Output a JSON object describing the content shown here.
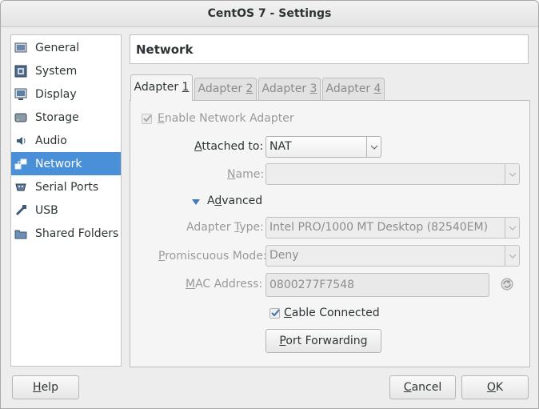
{
  "window": {
    "title": "CentOS 7 - Settings"
  },
  "sidebar": {
    "items": [
      {
        "label": "General",
        "icon": "general-icon"
      },
      {
        "label": "System",
        "icon": "system-icon"
      },
      {
        "label": "Display",
        "icon": "display-icon"
      },
      {
        "label": "Storage",
        "icon": "storage-icon"
      },
      {
        "label": "Audio",
        "icon": "audio-icon"
      },
      {
        "label": "Network",
        "icon": "network-icon",
        "selected": true
      },
      {
        "label": "Serial Ports",
        "icon": "serial-ports-icon"
      },
      {
        "label": "USB",
        "icon": "usb-icon"
      },
      {
        "label": "Shared Folders",
        "icon": "shared-folders-icon"
      }
    ]
  },
  "page": {
    "title": "Network"
  },
  "tabs": [
    {
      "text": "Adapter ",
      "num": "1",
      "active": true
    },
    {
      "text": "Adapter ",
      "num": "2"
    },
    {
      "text": "Adapter ",
      "num": "3"
    },
    {
      "text": "Adapter ",
      "num": "4"
    }
  ],
  "adapter": {
    "enable_label_pre": "",
    "enable_label_u": "E",
    "enable_label_post": "nable Network Adapter",
    "enabled_checked": true,
    "attached_to": {
      "label_u": "A",
      "label_post": "ttached to:",
      "value": "NAT"
    },
    "name": {
      "label_u": "N",
      "label_post": "ame:",
      "value": ""
    },
    "advanced": {
      "label_u": "d",
      "label_pre": "A",
      "label_post": "vanced",
      "expanded": true
    },
    "adapter_type": {
      "label_pre": "Adapter ",
      "label_u": "T",
      "label_post": "ype:",
      "value": "Intel PRO/1000 MT Desktop (82540EM)"
    },
    "promiscuous_mode": {
      "label_u": "P",
      "label_post": "romiscuous Mode:",
      "value": "Deny"
    },
    "mac_address": {
      "label_pre": "",
      "label_u": "M",
      "label_post": "AC Address:",
      "value": "0800277F7548"
    },
    "cable_connected": {
      "label_u": "C",
      "label_post": "able Connected",
      "checked": true
    },
    "port_forwarding": {
      "label_u": "P",
      "label_post": "ort Forwarding"
    }
  },
  "footer": {
    "help": {
      "label_u": "H",
      "label_post": "elp"
    },
    "cancel": {
      "label_u": "C",
      "label_post": "ancel"
    },
    "ok": {
      "label_u": "O",
      "label_post": "K"
    }
  },
  "colors": {
    "accent": "#4a90d9",
    "check": "#3a6fb0"
  }
}
